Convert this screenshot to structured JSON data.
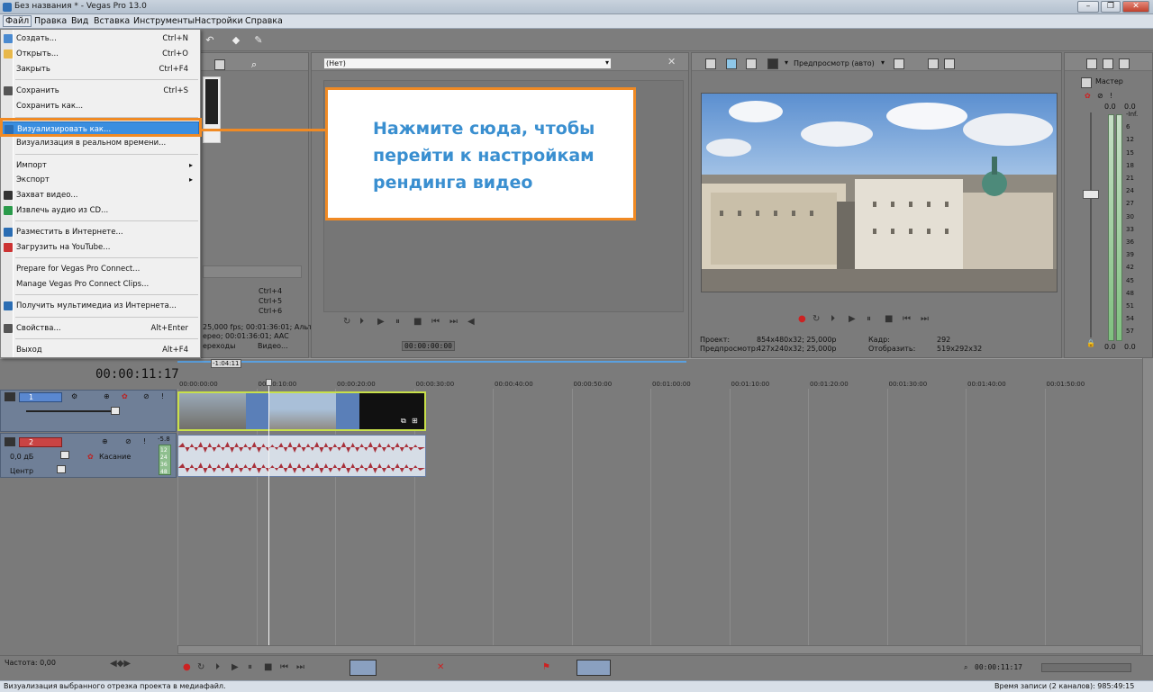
{
  "window": {
    "title": "Без названия * - Vegas Pro 13.0"
  },
  "menubar": [
    "Файл",
    "Правка",
    "Вид",
    "Вставка",
    "Инструменты",
    "Настройки",
    "Справка"
  ],
  "file_menu": {
    "items": [
      {
        "label": "Создать...",
        "shortcut": "Ctrl+N"
      },
      {
        "label": "Открыть...",
        "shortcut": "Ctrl+O"
      },
      {
        "label": "Закрыть",
        "shortcut": "Ctrl+F4"
      },
      {
        "label": "Сохранить",
        "shortcut": "Ctrl+S"
      },
      {
        "label": "Сохранить как...",
        "shortcut": ""
      },
      {
        "label": "Визуализировать как...",
        "shortcut": ""
      },
      {
        "label": "Визуализация в реальном времени...",
        "shortcut": ""
      },
      {
        "label": "Импорт",
        "shortcut": ""
      },
      {
        "label": "Экспорт",
        "shortcut": ""
      },
      {
        "label": "Захват видео...",
        "shortcut": ""
      },
      {
        "label": "Извлечь аудио из CD...",
        "shortcut": ""
      },
      {
        "label": "Разместить в Интернете...",
        "shortcut": ""
      },
      {
        "label": "Загрузить на YouTube...",
        "shortcut": ""
      },
      {
        "label": "Prepare for Vegas Pro Connect...",
        "shortcut": ""
      },
      {
        "label": "Manage Vegas Pro Connect Clips...",
        "shortcut": ""
      },
      {
        "label": "Получить мультимедиа из Интернета...",
        "shortcut": ""
      },
      {
        "label": "Свойства...",
        "shortcut": "Alt+Enter"
      },
      {
        "label": "Выход",
        "shortcut": "Alt+F4"
      }
    ]
  },
  "callout": {
    "text": "Нажмите сюда, чтобы перейти к настройкам рендинга видео"
  },
  "trimmer": {
    "dropdown_value": "(Нет)"
  },
  "explorer": {
    "shortcuts": [
      "Ctrl+4",
      "Ctrl+5",
      "Ctrl+6"
    ],
    "media_info_1": "25,000 fps; 00:01:36:01; Альт",
    "media_info_2": "ереo; 00:01:36:01; AAC",
    "col_1": "ереходы",
    "col_2": "Видео..."
  },
  "trimmer_timecode": "00:00:00:00",
  "preview": {
    "mode": "Предпросмотр (авто)",
    "project_label": "Проект:",
    "project_value": "854x480x32; 25,000p",
    "preview_label": "Предпросмотр:",
    "preview_value": "427x240x32; 25,000p",
    "frame_label": "Кадр:",
    "frame_value": "292",
    "display_label": "Отобразить:",
    "display_value": "519x292x32"
  },
  "master": {
    "label": "Мастер",
    "scale": [
      "-Inf.",
      "6",
      "12",
      "15",
      "18",
      "21",
      "24",
      "27",
      "30",
      "33",
      "36",
      "39",
      "42",
      "45",
      "48",
      "51",
      "54",
      "57"
    ],
    "left_value": "0.0",
    "right_value": "0.0"
  },
  "timeline": {
    "current_time": "00:00:11:17",
    "cursor_flag": "-1:04:11",
    "ruler": [
      "00:00:00:00",
      "00:00:10:00",
      "00:00:20:00",
      "00:00:30:00",
      "00:00:40:00",
      "00:00:50:00",
      "00:01:00:00",
      "00:01:10:00",
      "00:01:20:00",
      "00:01:30:00",
      "00:01:40:00",
      "00:01:50:00"
    ],
    "track1_number": "1",
    "track2_number": "2",
    "track2_volume": "0,0 дБ",
    "track2_pan": "Центр",
    "track2_mode": "Касание",
    "track2_level": "-5.8",
    "meter_levels": [
      "12",
      "24",
      "36",
      "48"
    ]
  },
  "bottom": {
    "rate_label": "Частота: 0,00",
    "timecode": "00:00:11:17",
    "record_time": "Время записи (2 каналов): 985:49:15"
  },
  "status": {
    "text": "Визуализация выбранного отрезка проекта в медиафайл."
  },
  "colors": {
    "accent": "#f08a24",
    "callout_text": "#3a8fd0",
    "menu_highlight": "#3a8ee0"
  }
}
